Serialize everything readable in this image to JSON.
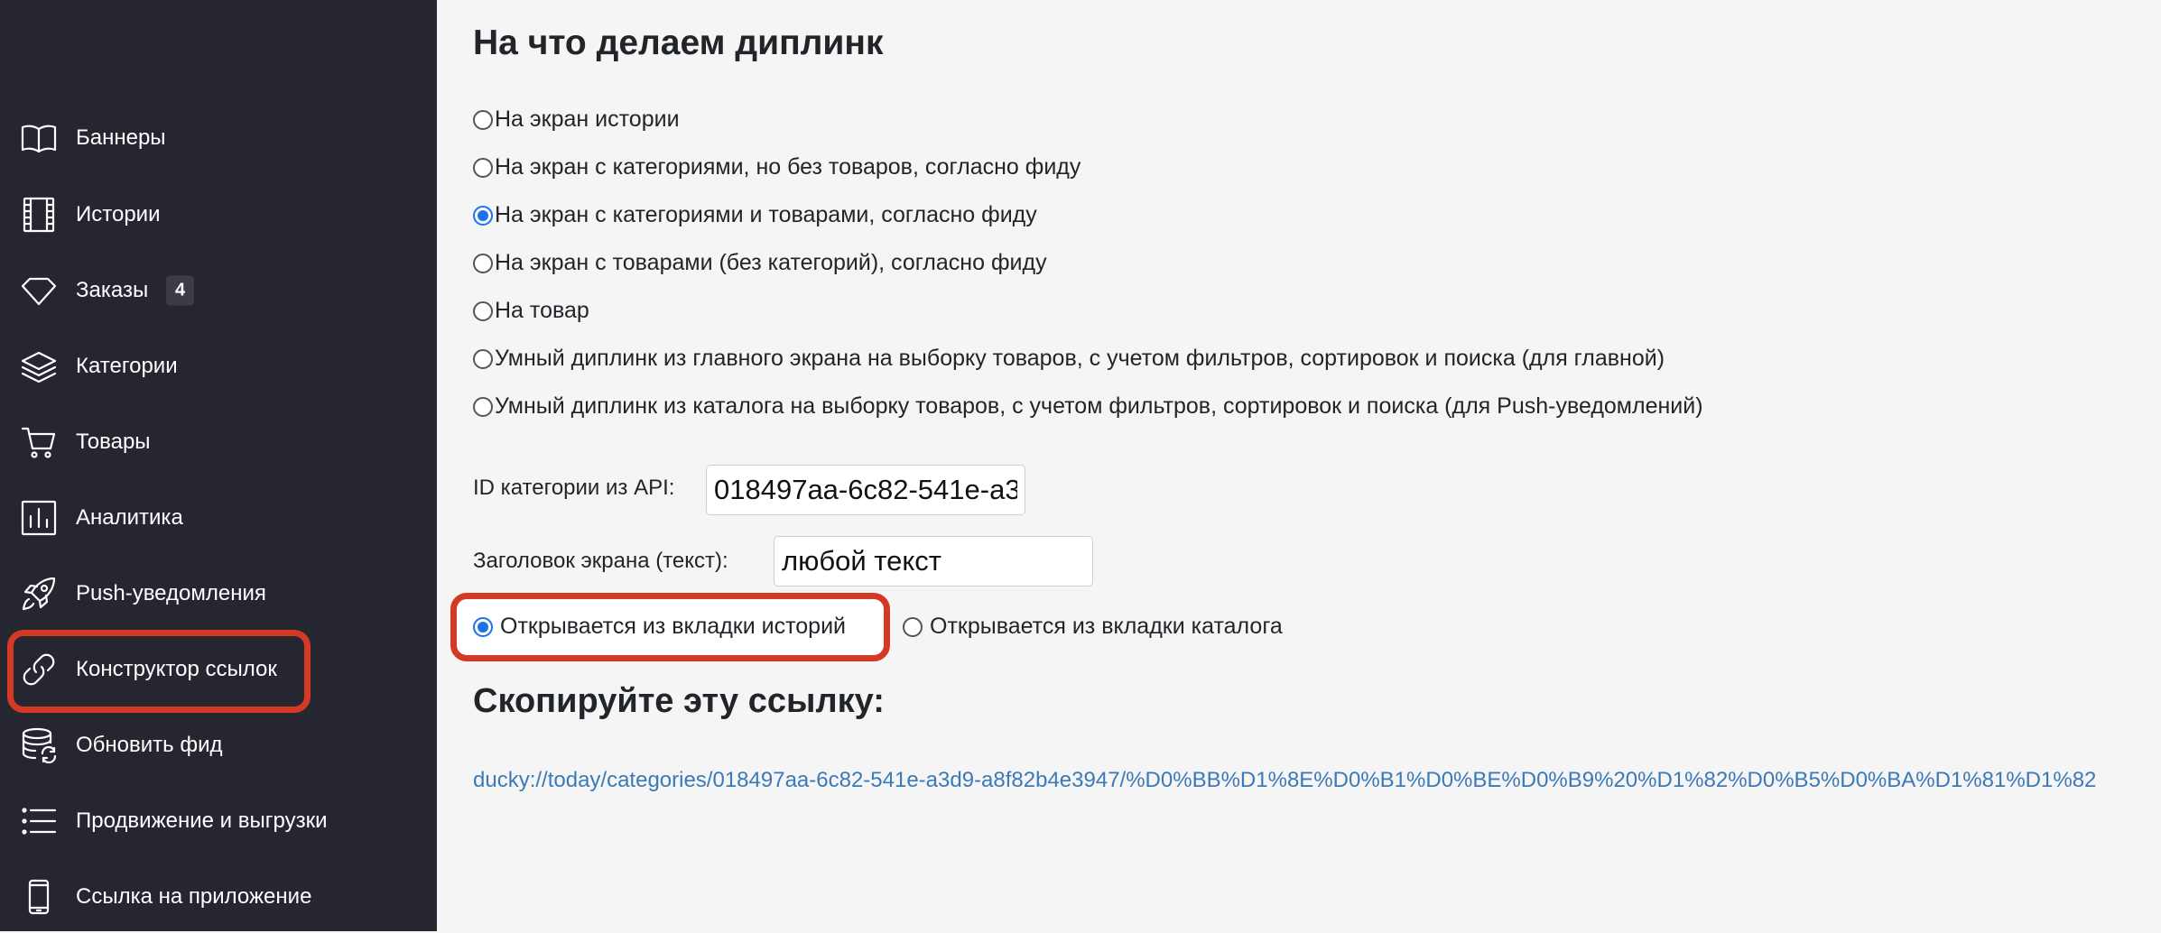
{
  "sidebar": {
    "items": [
      {
        "label": "Баннеры",
        "icon": "book-icon"
      },
      {
        "label": "Истории",
        "icon": "film-icon"
      },
      {
        "label": "Заказы",
        "icon": "diamond-icon",
        "badge": "4"
      },
      {
        "label": "Категории",
        "icon": "layers-icon"
      },
      {
        "label": "Товары",
        "icon": "cart-icon"
      },
      {
        "label": "Аналитика",
        "icon": "bar-chart-icon"
      },
      {
        "label": "Push-уведомления",
        "icon": "rocket-icon"
      },
      {
        "label": "Конструктор ссылок",
        "icon": "link-icon",
        "highlighted": true
      },
      {
        "label": "Обновить фид",
        "icon": "database-refresh-icon"
      },
      {
        "label": "Продвижение и выгрузки",
        "icon": "list-icon"
      },
      {
        "label": "Ссылка на приложение",
        "icon": "phone-icon"
      }
    ]
  },
  "main": {
    "title": "На что делаем диплинк",
    "targets": [
      {
        "label": "На экран истории",
        "checked": false
      },
      {
        "label": "На экран с категориями, но без товаров, согласно фиду",
        "checked": false
      },
      {
        "label": "На экран с категориями и товарами, согласно фиду",
        "checked": true
      },
      {
        "label": "На экран с товарами (без категорий), согласно фиду",
        "checked": false
      },
      {
        "label": "На товар",
        "checked": false
      },
      {
        "label": "Умный диплинк из главного экрана на выборку товаров, с учетом фильтров, сортировок и поиска (для главной)",
        "checked": false
      },
      {
        "label": "Умный диплинк из каталога на выборку товаров, с учетом фильтров, сортировок и поиска (для Push-уведомлений)",
        "checked": false
      }
    ],
    "category_id": {
      "label": "ID категории из API:",
      "value": "018497aa-6c82-541e-a3d9-a8f82b4e3947"
    },
    "screen_title": {
      "label": "Заголовок экрана (текст):",
      "value": "любой текст"
    },
    "source": [
      {
        "label": "Открывается из вкладки историй",
        "checked": true
      },
      {
        "label": "Открывается из вкладки каталога",
        "checked": false
      }
    ],
    "copy_heading": "Скопируйте эту ссылку:",
    "result_link": "ducky://today/categories/018497aa-6c82-541e-a3d9-a8f82b4e3947/%D0%BB%D1%8E%D0%B1%D0%BE%D0%B9%20%D1%82%D0%B5%D0%BA%D1%81%D1%82"
  },
  "colors": {
    "sidebar_bg": "#262631",
    "main_bg": "#f5f5f5",
    "highlight": "#d43a23",
    "radio_checked": "#1a73e8",
    "link": "#3b7ab8"
  }
}
